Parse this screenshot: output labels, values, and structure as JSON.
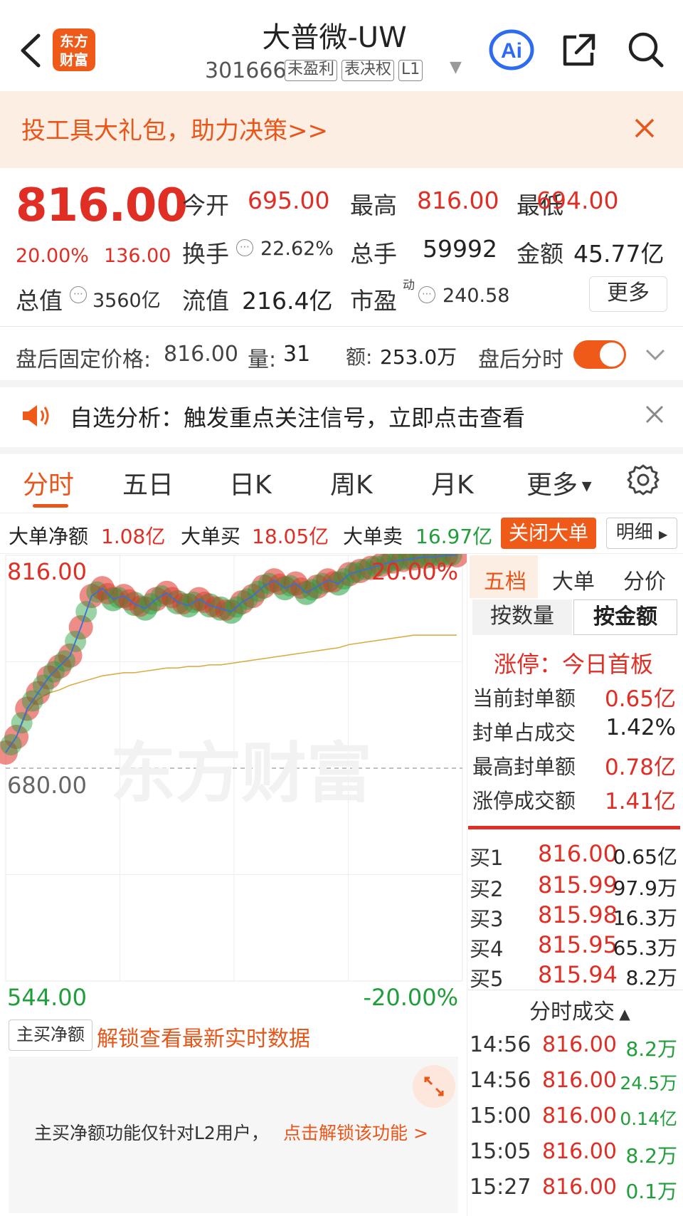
{
  "header": {
    "title": "大普微-UW",
    "code": "301666",
    "tags": [
      "未盈利",
      "表决权",
      "L1"
    ],
    "logo_text": [
      "东方",
      "财富"
    ]
  },
  "banner": {
    "text": "投工具大礼包，助力决策>>"
  },
  "quote": {
    "price": "816.00",
    "change_pct": "20.00%",
    "change_amt": "136.00",
    "open_label": "今开",
    "open": "695.00",
    "high_label": "最高",
    "high": "816.00",
    "low_label": "最低",
    "low": "694.00",
    "turnover_label": "换手",
    "turnover": "22.62%",
    "volume_label": "总手",
    "volume": "59992",
    "amount_label": "金额",
    "amount": "45.77亿",
    "mktcap_label": "总值",
    "mktcap": "3560亿",
    "float_label": "流值",
    "float": "216.4亿",
    "pe_label": "市盈",
    "pe_sup": "动",
    "pe": "240.58",
    "more_label": "更多"
  },
  "after_hours": {
    "label": "盘后固定价格:",
    "price": "816.00",
    "vol_label": "量:",
    "vol": "31",
    "amt_label": "额:",
    "amt": "253.0万",
    "toggle_label": "盘后分时",
    "toggle_on": true
  },
  "alert": {
    "text": "自选分析：触发重点关注信号，立即点击查看"
  },
  "tabs": [
    "分时",
    "五日",
    "日K",
    "周K",
    "月K",
    "更多"
  ],
  "big_order": {
    "net_label": "大单净额",
    "net": "1.08亿",
    "buy_label": "大单买",
    "buy": "18.05亿",
    "sell_label": "大单卖",
    "sell": "16.97亿",
    "close_label": "关闭大单",
    "detail_label": "明细"
  },
  "chart": {
    "top_price": "816.00",
    "top_pct": "20.00%",
    "mid_price": "680.00",
    "bottom_price": "544.00",
    "bottom_pct": "-20.00%",
    "watermark": "东方财富",
    "colors": {
      "up": "#e02e24",
      "down": "#1f9e3a",
      "avg": "#d9a93a"
    }
  },
  "chart_data": {
    "type": "line",
    "ylim": [
      544,
      816
    ],
    "price": [
      690,
      700,
      718,
      728,
      738,
      745,
      752,
      770,
      790,
      795,
      788,
      790,
      785,
      782,
      788,
      792,
      786,
      784,
      788,
      784,
      782,
      780,
      786,
      790,
      796,
      800,
      795,
      798,
      792,
      796,
      800,
      798,
      804,
      806,
      808,
      810,
      812,
      813,
      814,
      815,
      815,
      816,
      816
    ],
    "avg": [
      690,
      700,
      716,
      724,
      728,
      730,
      733,
      735,
      737,
      739,
      740,
      741,
      741,
      742,
      743,
      744,
      744,
      745,
      745,
      746,
      746,
      747,
      748,
      749,
      750,
      751,
      752,
      753,
      754,
      755,
      756,
      757,
      759,
      760,
      761,
      762,
      763,
      764,
      765,
      765,
      765,
      765,
      765
    ]
  },
  "sub": {
    "dropdown": "主买净额",
    "unlock": "解锁查看最新实时数据",
    "lock_msg": "主买净额功能仅针对L2用户，",
    "lock_link": "点击解锁该功能 >"
  },
  "right": {
    "tabs": [
      "五档",
      "大单",
      "分价"
    ],
    "seg": [
      "按数量",
      "按金额"
    ],
    "limit_title": "涨停：今日首板",
    "limit_rows": [
      {
        "label": "当前封单额",
        "value": "0.65亿"
      },
      {
        "label": "封单占成交",
        "value": "1.42%"
      },
      {
        "label": "最高封单额",
        "value": "0.78亿"
      },
      {
        "label": "涨停成交额",
        "value": "1.41亿"
      }
    ],
    "bids": [
      {
        "label": "买1",
        "price": "816.00",
        "vol": "0.65亿"
      },
      {
        "label": "买2",
        "price": "815.99",
        "vol": "97.9万"
      },
      {
        "label": "买3",
        "price": "815.98",
        "vol": "16.3万"
      },
      {
        "label": "买4",
        "price": "815.95",
        "vol": "65.3万"
      },
      {
        "label": "买5",
        "price": "815.94",
        "vol": "8.2万"
      }
    ],
    "ticks_header": "分时成交",
    "ticks": [
      {
        "time": "14:56",
        "price": "816.00",
        "vol": "8.2万"
      },
      {
        "time": "14:56",
        "price": "816.00",
        "vol": "24.5万"
      },
      {
        "time": "15:00",
        "price": "816.00",
        "vol": "0.14亿"
      },
      {
        "time": "15:05",
        "price": "816.00",
        "vol": "8.2万"
      },
      {
        "time": "15:27",
        "price": "816.00",
        "vol": "0.1万"
      }
    ]
  }
}
